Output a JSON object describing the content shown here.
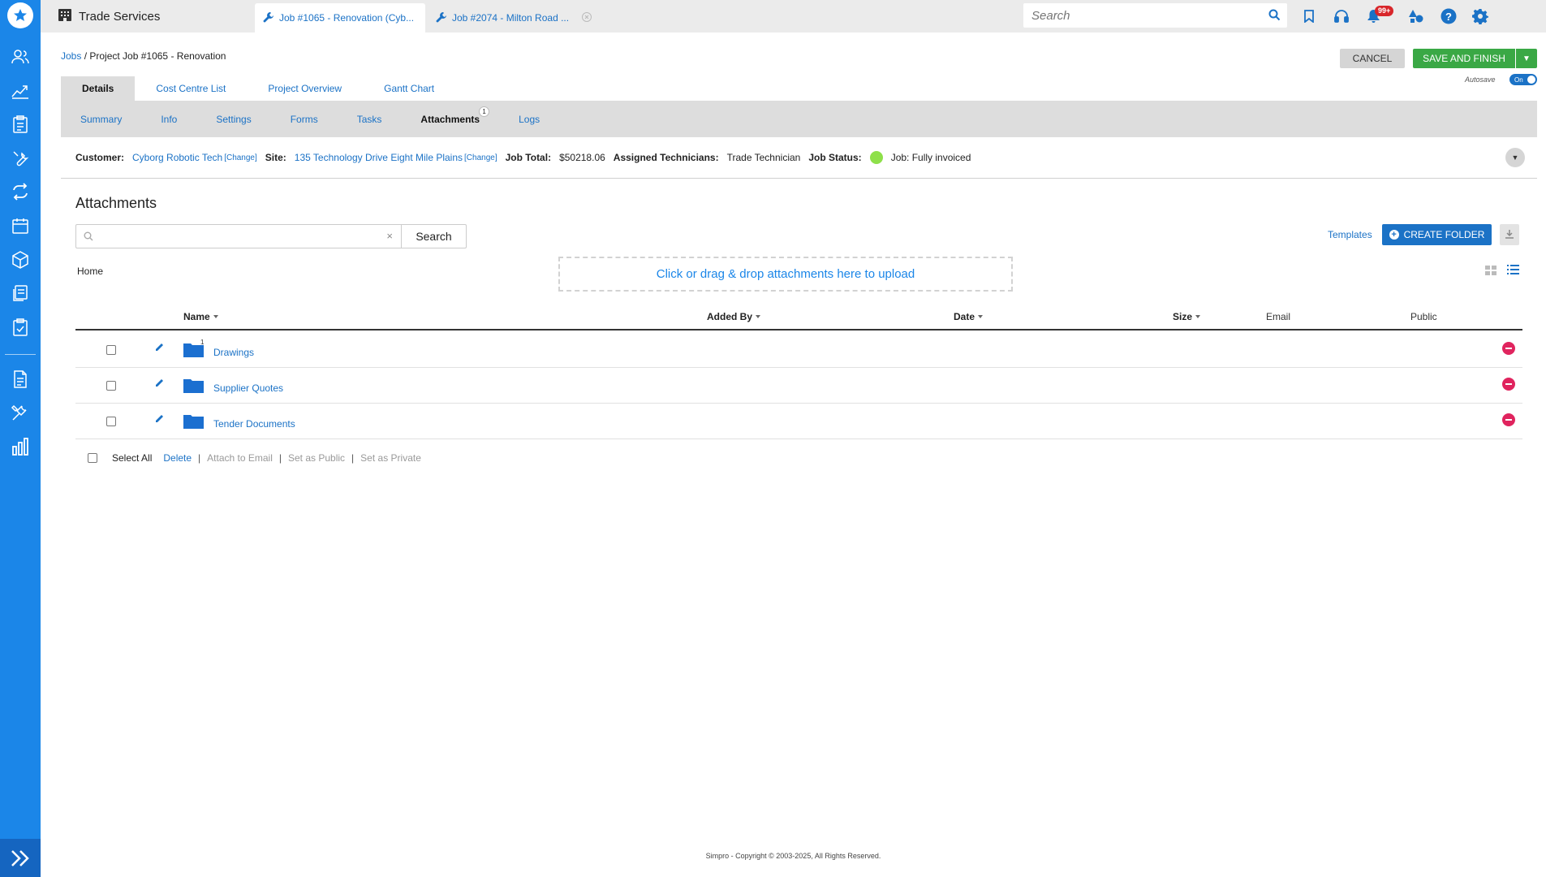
{
  "app": {
    "title": "Trade Services"
  },
  "open_tabs": [
    {
      "label": "Job #1065 - Renovation (Cyb..."
    },
    {
      "label": "Job #2074 - Milton Road ..."
    }
  ],
  "global_search": {
    "placeholder": "Search"
  },
  "notifications": {
    "badge": "99+"
  },
  "breadcrumb": {
    "root": "Jobs",
    "separator": " / ",
    "current": "Project Job #1065 - Renovation"
  },
  "actions": {
    "cancel": "CANCEL",
    "save": "SAVE AND FINISH",
    "autosave_label": "Autosave",
    "autosave_state": "On"
  },
  "main_tabs": [
    "Details",
    "Cost Centre List",
    "Project Overview",
    "Gantt Chart"
  ],
  "sub_tabs": [
    "Summary",
    "Info",
    "Settings",
    "Forms",
    "Tasks",
    "Attachments",
    "Logs"
  ],
  "attachments_count": "1",
  "info": {
    "customer_label": "Customer:",
    "customer": "Cyborg Robotic Tech",
    "change": "[Change]",
    "site_label": "Site:",
    "site": "135 Technology Drive Eight Mile Plains",
    "job_total_label": "Job Total:",
    "job_total": "$50218.06",
    "technicians_label": "Assigned Technicians:",
    "technicians": "Trade Technician",
    "status_label": "Job Status:",
    "status": "Job: Fully invoiced",
    "status_color": "#8ee04a"
  },
  "attachments": {
    "title": "Attachments",
    "search_placeholder": "",
    "search_button": "Search",
    "templates": "Templates",
    "create_folder": "CREATE FOLDER",
    "home": "Home",
    "dropzone": "Click or drag & drop attachments here to upload",
    "columns": [
      "Name",
      "Added By",
      "Date",
      "Size",
      "Email",
      "Public"
    ],
    "rows": [
      {
        "name": "Drawings",
        "count": "1"
      },
      {
        "name": "Supplier Quotes",
        "count": ""
      },
      {
        "name": "Tender Documents",
        "count": ""
      }
    ],
    "bulk": {
      "select_all": "Select All",
      "delete": "Delete",
      "attach_email": "Attach to Email",
      "set_public": "Set as Public",
      "set_private": "Set as Private"
    }
  },
  "footer": "Simpro - Copyright © 2003-2025, All Rights Reserved.",
  "colors": {
    "accent": "#1b72c6",
    "rail": "#1b86e8",
    "save": "#3aa845",
    "delete": "#e0245e"
  }
}
